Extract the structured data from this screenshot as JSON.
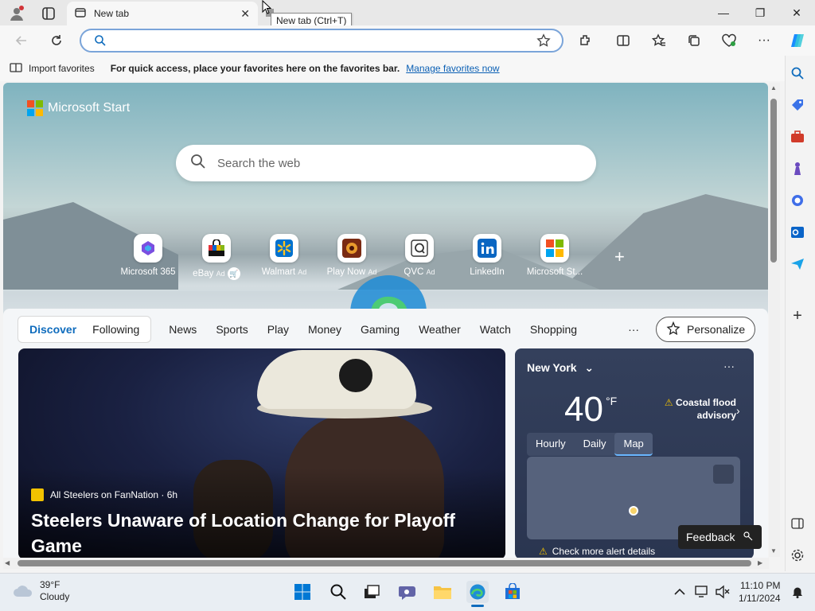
{
  "browser": {
    "tab_title": "New tab",
    "new_tab_tooltip": "New tab (Ctrl+T)",
    "address_placeholder": ""
  },
  "favorites_bar": {
    "import_label": "Import favorites",
    "hint": "For quick access, place your favorites here on the favorites bar.",
    "manage_link": "Manage favorites now"
  },
  "start": {
    "brand": "Microsoft Start",
    "search_placeholder": "Search the web",
    "tiles": [
      {
        "label": "Microsoft 365",
        "ad": ""
      },
      {
        "label": "eBay",
        "ad": "Ad"
      },
      {
        "label": "Walmart",
        "ad": "Ad"
      },
      {
        "label": "Play Now",
        "ad": "Ad"
      },
      {
        "label": "QVC",
        "ad": "Ad"
      },
      {
        "label": "LinkedIn",
        "ad": ""
      },
      {
        "label": "Microsoft St...",
        "ad": ""
      }
    ]
  },
  "feed": {
    "segments": [
      "Discover",
      "Following"
    ],
    "nav": [
      "News",
      "Sports",
      "Play",
      "Money",
      "Gaming",
      "Weather",
      "Watch",
      "Shopping"
    ],
    "more": "···",
    "personalize": "Personalize"
  },
  "news": {
    "source": "All Steelers on FanNation · 6h",
    "headline": "Steelers Unaware of Location Change for Playoff Game"
  },
  "weather": {
    "city": "New York",
    "more": "···",
    "temp": "40",
    "unit": "°F",
    "alert": "Coastal flood advisory",
    "tabs": [
      "Hourly",
      "Daily",
      "Map"
    ],
    "check_alert": "Check more alert details"
  },
  "feedback": "Feedback",
  "taskbar": {
    "weather_temp": "39°F",
    "weather_desc": "Cloudy",
    "time": "11:10 PM",
    "date": "1/11/2024"
  },
  "colors": {
    "accent": "#0f6cbd",
    "link": "#0a5fb4",
    "weather_card": "#34405c"
  }
}
